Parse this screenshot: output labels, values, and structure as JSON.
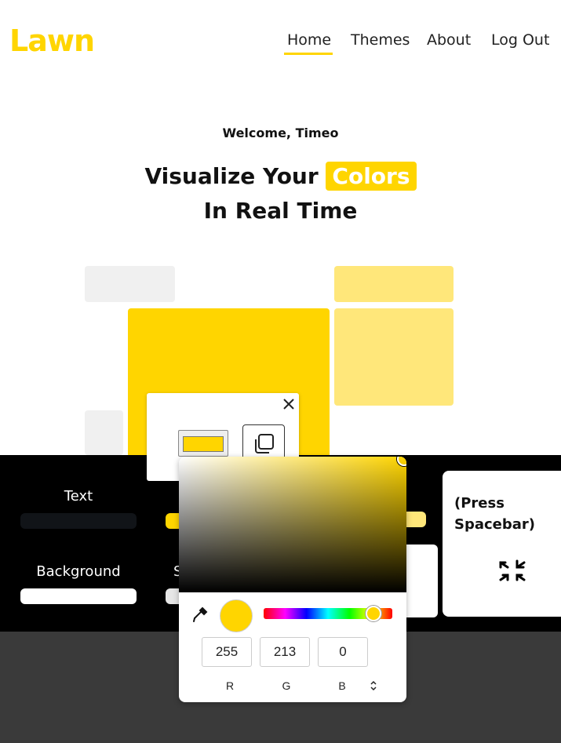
{
  "colors": {
    "accent": "#FFD500",
    "accent_light": "#FFE77A",
    "placeholder": "#F0F0F0",
    "dark": "#000000",
    "footer": "#3A3A3A"
  },
  "header": {
    "logo": "Lawn",
    "nav": [
      {
        "label": "Home",
        "active": true
      },
      {
        "label": "Themes"
      },
      {
        "label": "About"
      },
      {
        "label": "Log Out"
      }
    ]
  },
  "hero": {
    "welcome": "Welcome, Timeo",
    "line1_prefix": "Visualize Your",
    "line1_highlight": "Colors",
    "line2": "In Real Time"
  },
  "swatches": [
    {
      "label": "Text",
      "color": "#111418"
    },
    {
      "label": "Background",
      "color": "#FFFFFF"
    }
  ],
  "hint": {
    "text_line1": "(Press",
    "text_line2": "Spacebar)",
    "icon": "shrink-arrows-icon"
  },
  "popover": {
    "close_icon": "close-icon",
    "copy_icon": "copy-icon"
  },
  "picker": {
    "eyedropper_icon": "eyedropper-icon",
    "r": "255",
    "g": "213",
    "b": "0",
    "r_label": "R",
    "g_label": "G",
    "b_label": "B",
    "mode_toggle_icon": "updown-chevron-icon"
  }
}
